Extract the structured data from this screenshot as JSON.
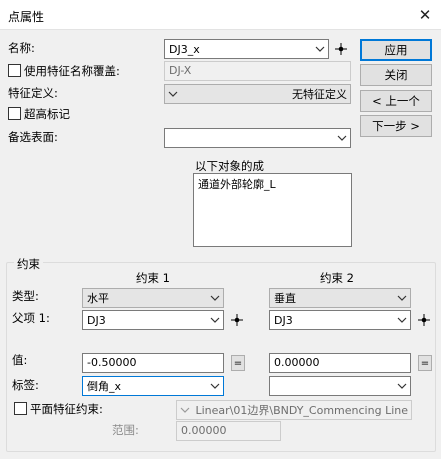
{
  "window": {
    "title": "点属性"
  },
  "buttons": {
    "apply": "应用",
    "close": "关闭",
    "prev": "< 上一个",
    "next": "下一步 >"
  },
  "name": {
    "label": "名称:",
    "value": "DJ3_x"
  },
  "override": {
    "label": "使用特征名称覆盖:",
    "value": "DJ-X"
  },
  "feature_def": {
    "label": "特征定义:",
    "value": "无特征定义"
  },
  "super_mark": {
    "label": "超高标记"
  },
  "alt_surface": {
    "label": "备选表面:",
    "value": ""
  },
  "composed_of": {
    "label": "以下对象的成",
    "items": [
      "通道外部轮廓_L"
    ]
  },
  "constraints": {
    "group_label": "约束",
    "col1_header": "约束 1",
    "col2_header": "约束 2",
    "type_label": "类型:",
    "parent_label": "父项 1:",
    "value_label": "值:",
    "tag_label": "标签:",
    "c1": {
      "type": "水平",
      "parent": "DJ3",
      "value": "-0.50000",
      "tag": "倒角_x"
    },
    "c2": {
      "type": "垂直",
      "parent": "DJ3",
      "value": "0.00000",
      "tag": ""
    },
    "eq_symbol": "=",
    "plane": {
      "label": "平面特征约束:",
      "value": "Linear\\01边界\\BNDY_Commencing Line"
    },
    "range": {
      "label": "范围:",
      "value": "0.00000"
    }
  }
}
